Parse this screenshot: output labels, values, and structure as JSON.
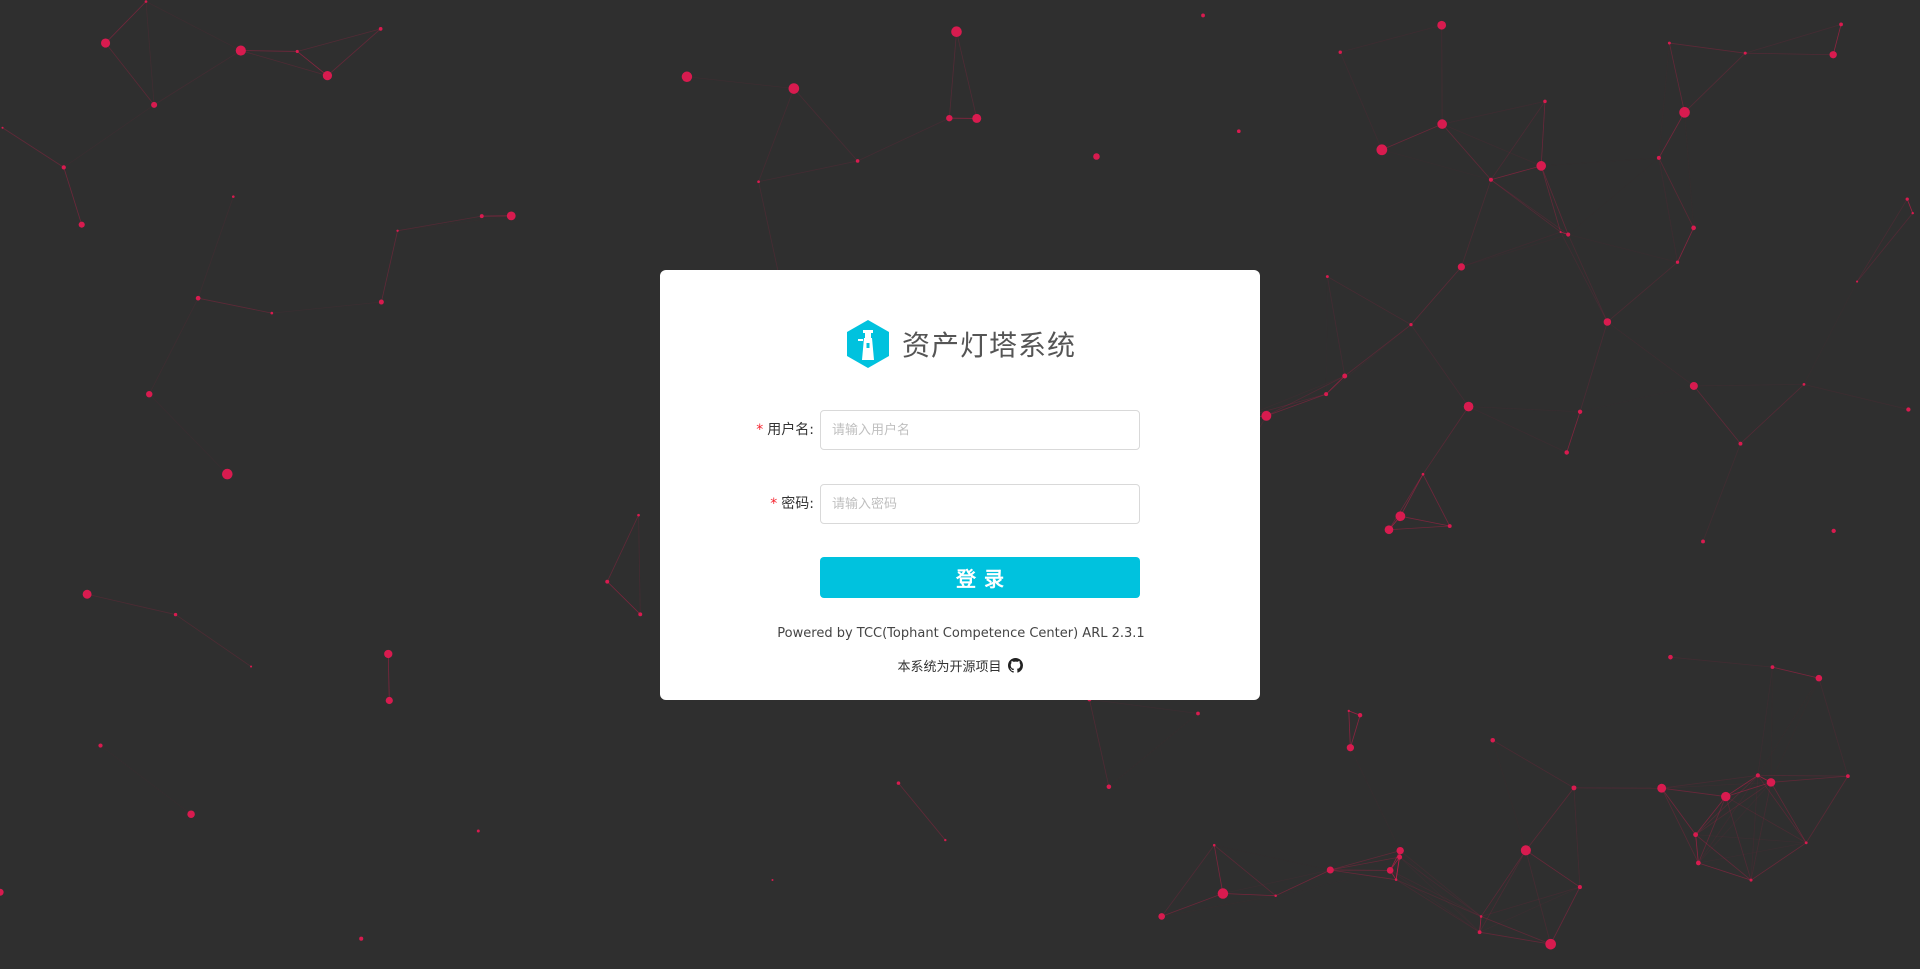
{
  "app": {
    "title": "资产灯塔系统"
  },
  "login": {
    "username_label": "用户名:",
    "username_placeholder": "请输入用户名",
    "username_value": "",
    "password_label": "密码:",
    "password_placeholder": "请输入密码",
    "password_value": "",
    "required_mark": "*",
    "submit_label": "登录"
  },
  "footer": {
    "powered_by": "Powered by TCC(Tophant Competence Center) ARL 2.3.1",
    "open_source_text": "本系统为开源项目",
    "github_icon": "github-icon"
  },
  "colors": {
    "background": "#2f2f2f",
    "network_accent": "#d81b4f",
    "brand_accent": "#00c2de",
    "required": "#f5222d"
  }
}
